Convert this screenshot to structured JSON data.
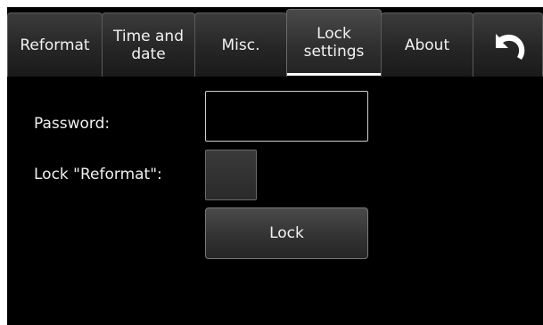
{
  "tabs": [
    {
      "label": "Reformat"
    },
    {
      "label": "Time and\ndate"
    },
    {
      "label": "Misc."
    },
    {
      "label": "Lock\nsettings",
      "active": true
    },
    {
      "label": "About"
    }
  ],
  "back_icon": "undo-arrow-icon",
  "lock_settings": {
    "password_label": "Password:",
    "password_value": "",
    "lock_reformat_label": "Lock \"Reformat\":",
    "lock_reformat_checked": false,
    "lock_button_label": "Lock"
  }
}
